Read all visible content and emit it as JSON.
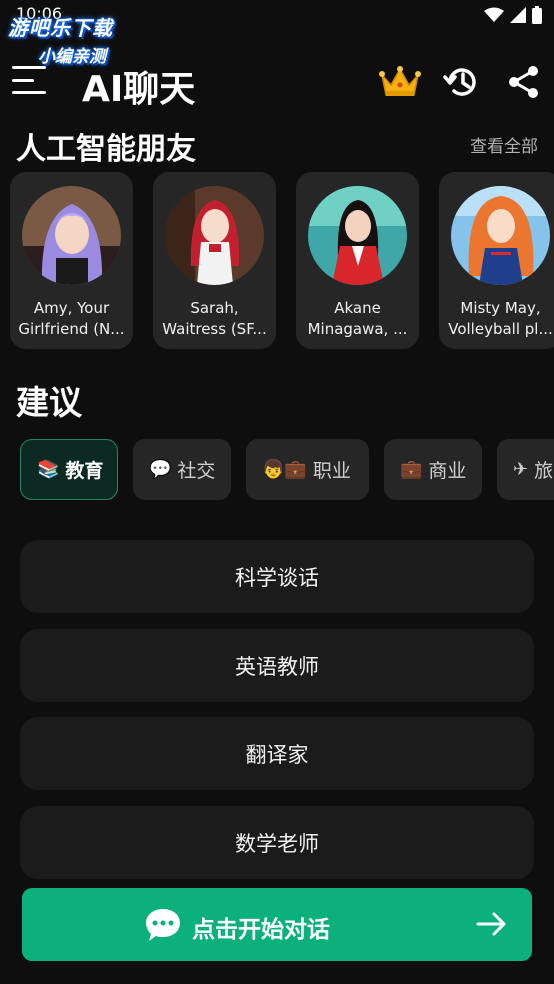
{
  "status_bar": {
    "time": "10:06"
  },
  "watermark": {
    "line1": "游吧乐下载",
    "line2": "小编亲测"
  },
  "header": {
    "title": "AI聊天"
  },
  "friends": {
    "title": "人工智能朋友",
    "see_all": "查看全部",
    "items": [
      {
        "name": "Amy, Your Girlfriend (N..."
      },
      {
        "name": "Sarah, Waitress (SF..."
      },
      {
        "name": "Akane Minagawa, ..."
      },
      {
        "name": "Misty May, Volleyball pl..."
      }
    ]
  },
  "suggestions": {
    "title": "建议",
    "categories": [
      {
        "emoji": "📚",
        "label": "教育",
        "active": true
      },
      {
        "emoji": "💬",
        "label": "社交",
        "active": false
      },
      {
        "emoji": "👦💼",
        "label": "职业",
        "active": false
      },
      {
        "emoji": "💼",
        "label": "商业",
        "active": false
      },
      {
        "emoji": "✈",
        "label": "旅",
        "active": false
      }
    ],
    "topics": [
      "科学谈话",
      "英语教师",
      "翻译家",
      "数学老师"
    ]
  },
  "cta": {
    "label": "点击开始对话"
  },
  "colors": {
    "accent": "#0bb07b",
    "background": "#0e0e0e",
    "card": "#262626"
  }
}
